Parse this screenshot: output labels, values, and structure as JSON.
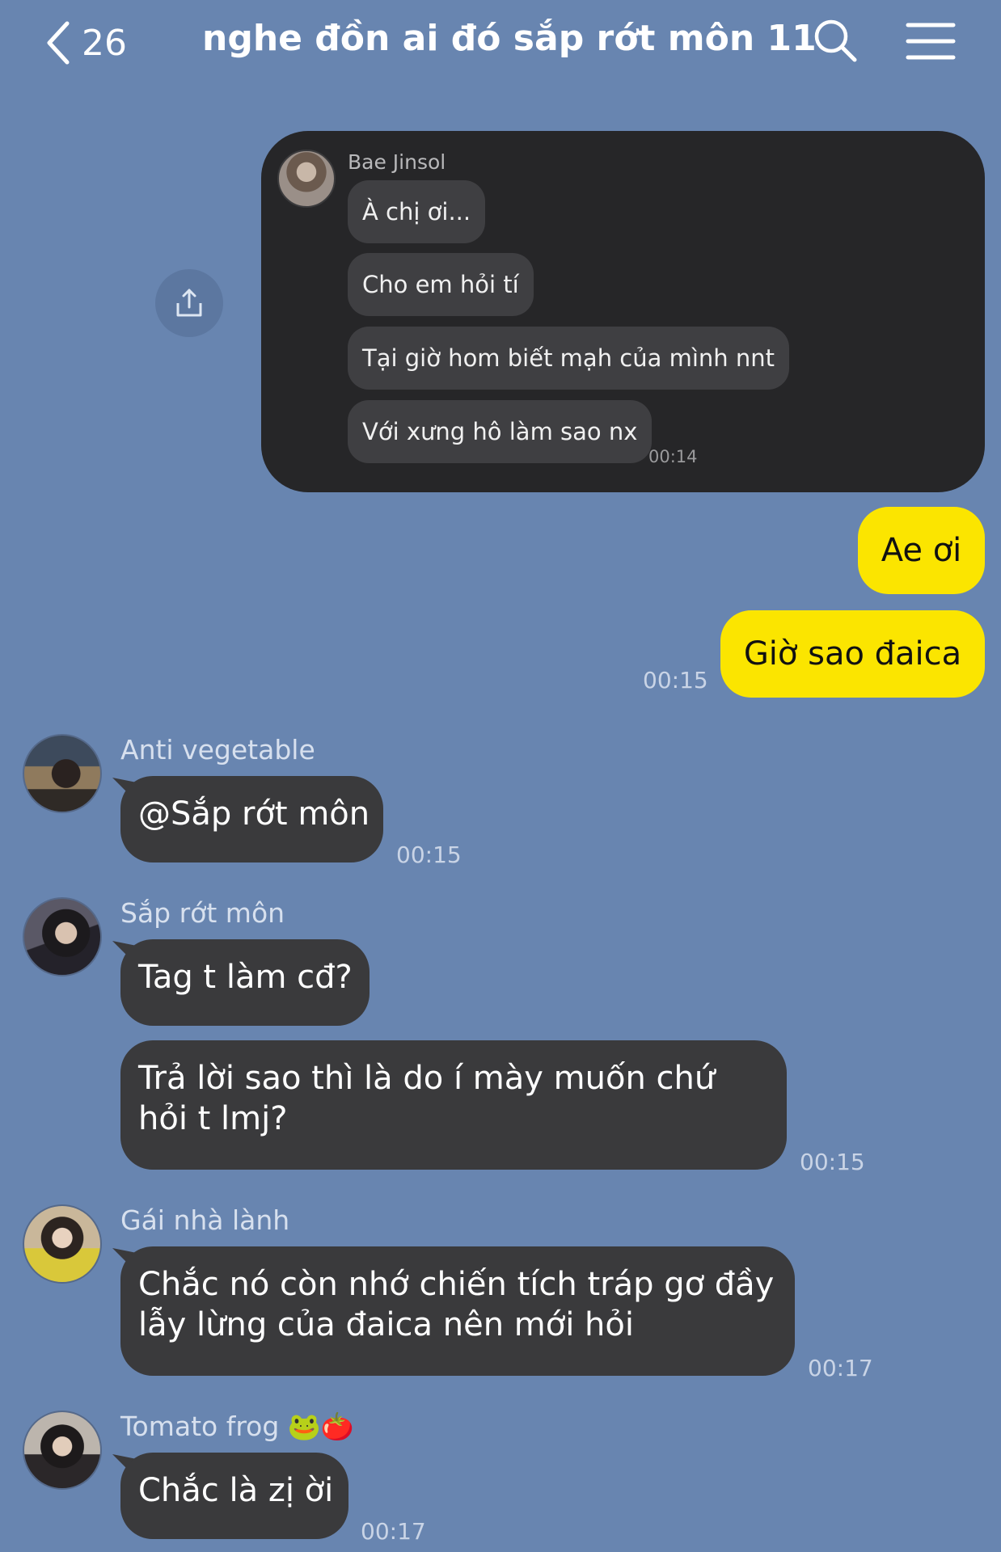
{
  "header": {
    "back_count": "26",
    "title": "nghe đồn ai đó sắp rớt môn 11"
  },
  "forwarded": {
    "sender": "Bae Jinsol",
    "messages": [
      "À chị ơi...",
      "Cho em hỏi tí",
      "Tại giờ hom biết mạh của mình nnt",
      "Với xưng hô làm sao nx"
    ],
    "time": "00:14"
  },
  "outgoing": {
    "messages": [
      "Ae ơi",
      "Giờ sao đaica"
    ],
    "time": "00:15"
  },
  "groups": [
    {
      "sender": "Anti vegetable",
      "messages": [
        "@Sắp rớt môn"
      ],
      "time": "00:15"
    },
    {
      "sender": "Sắp rớt môn",
      "messages": [
        "Tag t làm cđ?",
        "Trả lời sao thì là do í mày muốn chứ hỏi t lmj?"
      ],
      "time": "00:15"
    },
    {
      "sender": "Gái nhà lành",
      "messages": [
        "Chắc nó còn nhớ chiến tích tráp gơ đầy lẫy lừng của đaica nên mới hỏi"
      ],
      "time": "00:17"
    },
    {
      "sender": "Tomato frog",
      "sender_emoji": "🐸🍅",
      "messages": [
        "Chắc là zị ời"
      ],
      "time": "00:17"
    }
  ],
  "colors": {
    "background": "#6885b0",
    "outgoing_bubble": "#fbe500",
    "incoming_bubble": "#3a3a3c",
    "forwarded_card": "#262628"
  }
}
